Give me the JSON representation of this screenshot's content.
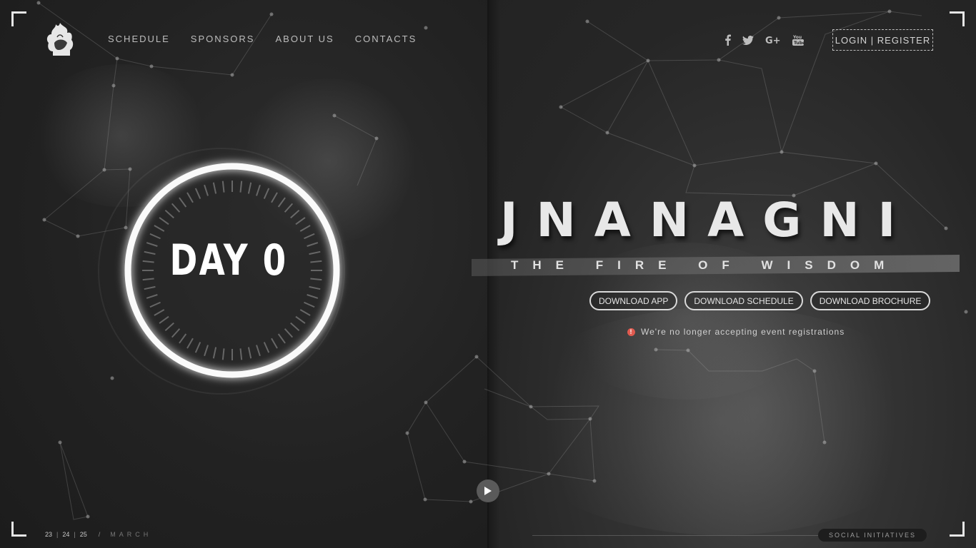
{
  "brand": {
    "logo_icon": "flaming-head-icon"
  },
  "nav": {
    "items": [
      "SCHEDULE",
      "SPONSORS",
      "ABOUT US",
      "CONTACTS"
    ]
  },
  "social": {
    "icons": [
      "facebook-icon",
      "twitter-icon",
      "google-plus-icon",
      "youtube-icon"
    ]
  },
  "auth": {
    "label": "LOGIN | REGISTER"
  },
  "countdown": {
    "label": "DAY 0"
  },
  "hero": {
    "title": "JNANAGNI",
    "tagline": "THE FIRE OF WISDOM",
    "buttons": [
      "DOWNLOAD APP",
      "DOWNLOAD SCHEDULE",
      "DOWNLOAD BROCHURE"
    ],
    "notice": "We're no longer accepting event registrations"
  },
  "footer": {
    "dates": [
      "23",
      "24",
      "25"
    ],
    "separator": "/",
    "month": "MARCH",
    "social_initiatives": "SOCIAL INITIATIVES"
  },
  "colors": {
    "alert": "#e05a4f",
    "background": "#242424",
    "text": "#cfcfcf"
  }
}
